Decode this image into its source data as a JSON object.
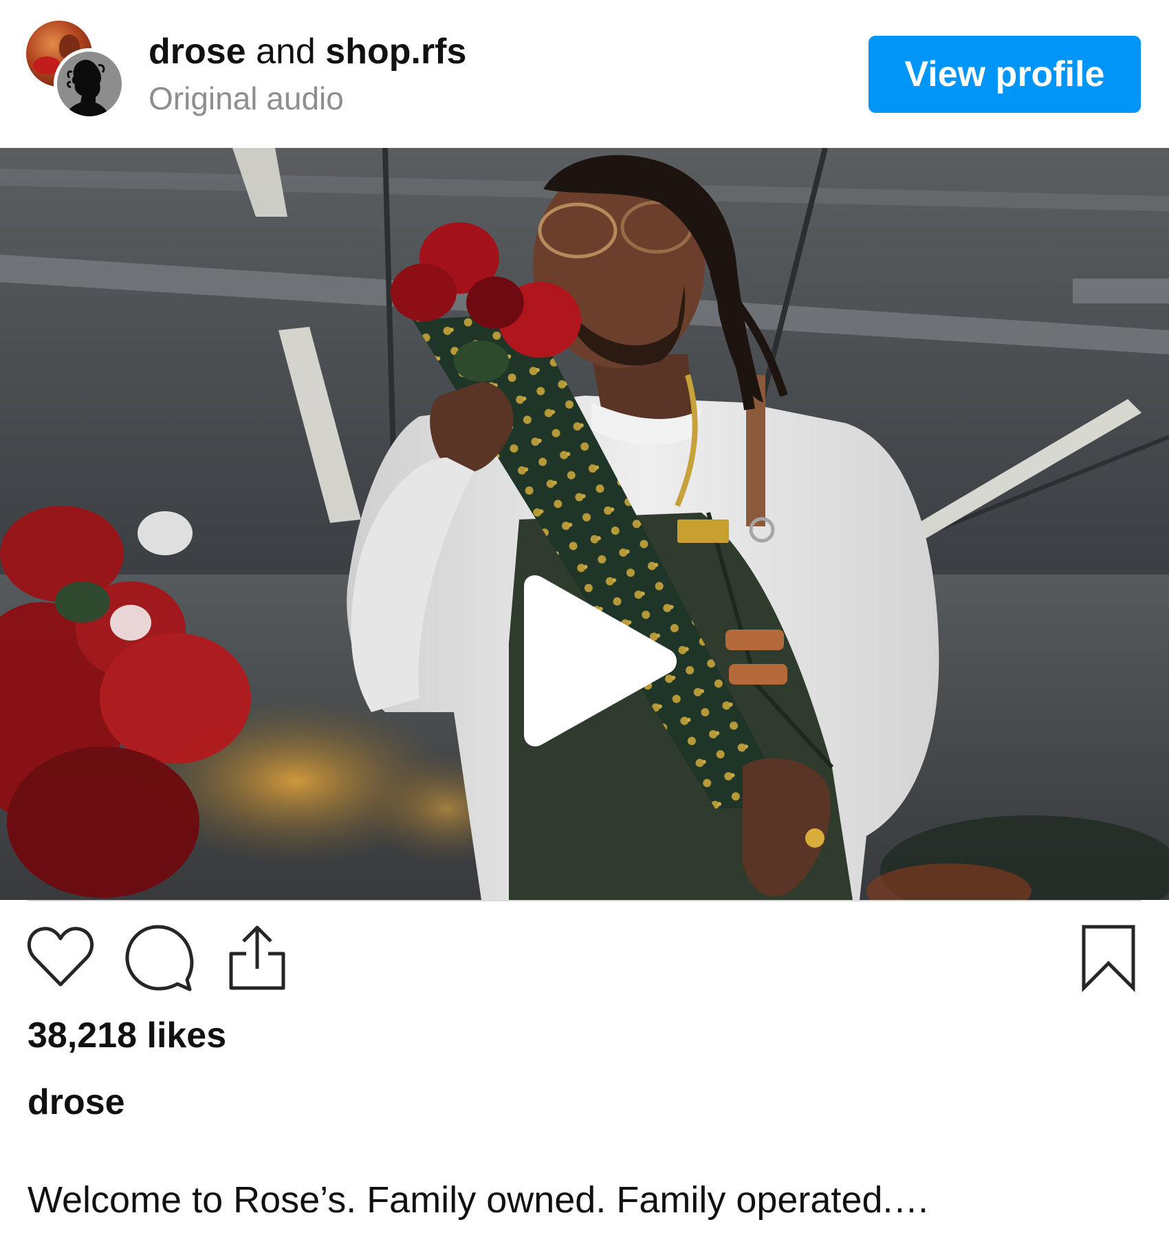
{
  "header": {
    "user_primary": "drose",
    "conjunction": "and",
    "user_secondary": "shop.rfs",
    "audio_label": "Original audio",
    "view_profile_label": "View profile"
  },
  "colors": {
    "accent": "#0095f6",
    "secondary_text": "#8e8e8e",
    "primary_text": "#111111"
  },
  "video": {
    "state": "paused",
    "overlay_icon": "play-icon"
  },
  "actions": {
    "icons": [
      "heart-icon",
      "comment-icon",
      "share-icon",
      "bookmark-icon"
    ]
  },
  "post": {
    "likes": "38,218 likes",
    "caption_user": "drose",
    "caption_text": "Welcome to Rose’s. Family owned. Family operated.…"
  }
}
